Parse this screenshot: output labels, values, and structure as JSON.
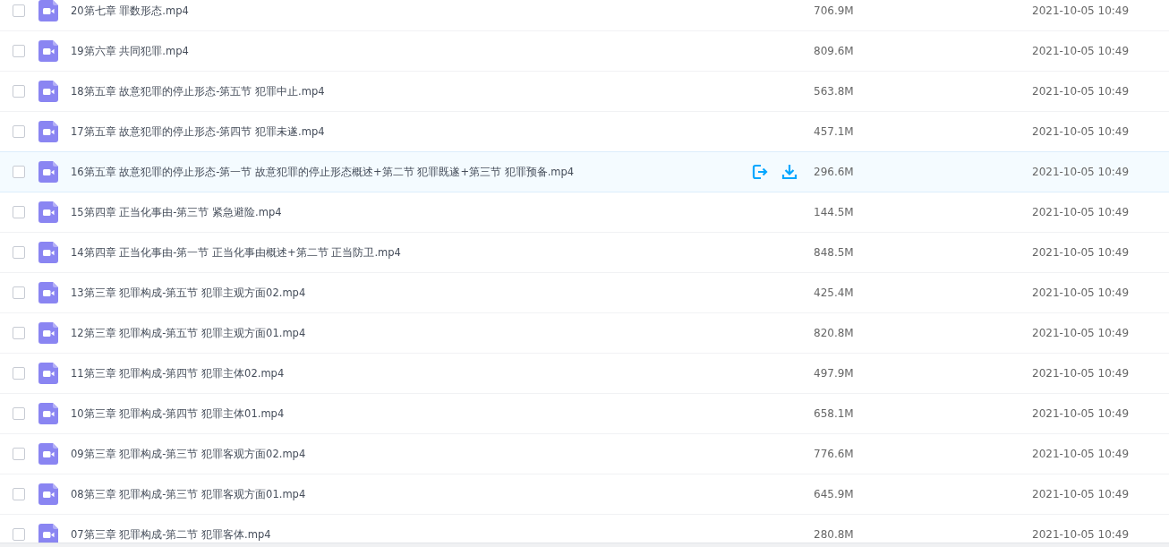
{
  "files": [
    {
      "name": "20第七章 罪数形态.mp4",
      "size": "706.9M",
      "modified": "2021-10-05 10:49",
      "checked": false,
      "highlighted": false
    },
    {
      "name": "19第六章 共同犯罪.mp4",
      "size": "809.6M",
      "modified": "2021-10-05 10:49",
      "checked": false,
      "highlighted": false
    },
    {
      "name": "18第五章 故意犯罪的停止形态-第五节 犯罪中止.mp4",
      "size": "563.8M",
      "modified": "2021-10-05 10:49",
      "checked": false,
      "highlighted": false
    },
    {
      "name": "17第五章 故意犯罪的停止形态-第四节 犯罪未遂.mp4",
      "size": "457.1M",
      "modified": "2021-10-05 10:49",
      "checked": false,
      "highlighted": false
    },
    {
      "name": "16第五章 故意犯罪的停止形态-第一节 故意犯罪的停止形态概述+第二节 犯罪既遂+第三节 犯罪预备.mp4",
      "size": "296.6M",
      "modified": "2021-10-05 10:49",
      "checked": false,
      "highlighted": true
    },
    {
      "name": "15第四章 正当化事由-第三节 紧急避险.mp4",
      "size": "144.5M",
      "modified": "2021-10-05 10:49",
      "checked": false,
      "highlighted": false
    },
    {
      "name": "14第四章 正当化事由-第一节 正当化事由概述+第二节 正当防卫.mp4",
      "size": "848.5M",
      "modified": "2021-10-05 10:49",
      "checked": false,
      "highlighted": false
    },
    {
      "name": "13第三章 犯罪构成-第五节 犯罪主观方面02.mp4",
      "size": "425.4M",
      "modified": "2021-10-05 10:49",
      "checked": false,
      "highlighted": false
    },
    {
      "name": "12第三章 犯罪构成-第五节 犯罪主观方面01.mp4",
      "size": "820.8M",
      "modified": "2021-10-05 10:49",
      "checked": false,
      "highlighted": false
    },
    {
      "name": "11第三章 犯罪构成-第四节 犯罪主体02.mp4",
      "size": "497.9M",
      "modified": "2021-10-05 10:49",
      "checked": false,
      "highlighted": false
    },
    {
      "name": "10第三章 犯罪构成-第四节 犯罪主体01.mp4",
      "size": "658.1M",
      "modified": "2021-10-05 10:49",
      "checked": false,
      "highlighted": false
    },
    {
      "name": "09第三章 犯罪构成-第三节 犯罪客观方面02.mp4",
      "size": "776.6M",
      "modified": "2021-10-05 10:49",
      "checked": false,
      "highlighted": false
    },
    {
      "name": "08第三章 犯罪构成-第三节 犯罪客观方面01.mp4",
      "size": "645.9M",
      "modified": "2021-10-05 10:49",
      "checked": false,
      "highlighted": false
    },
    {
      "name": "07第三章 犯罪构成-第二节 犯罪客体.mp4",
      "size": "280.8M",
      "modified": "2021-10-05 10:49",
      "checked": false,
      "highlighted": false
    }
  ]
}
